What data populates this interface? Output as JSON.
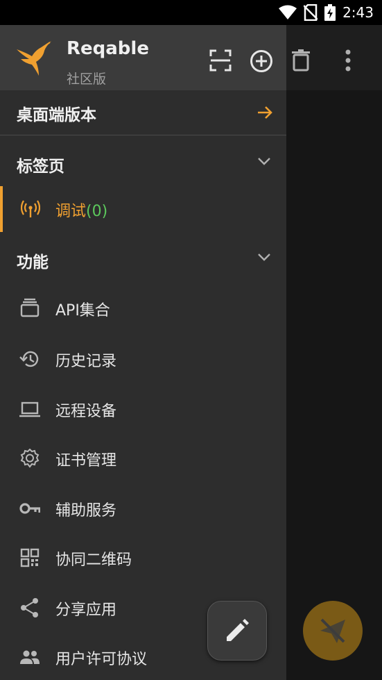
{
  "status": {
    "time": "2:43"
  },
  "header": {
    "app_name": "Reqable",
    "edition": "社区版"
  },
  "desktop": {
    "label": "桌面端版本"
  },
  "tabs_section": {
    "title": "标签页"
  },
  "active_tab": {
    "label": "调试",
    "count": "(0)"
  },
  "features_section": {
    "title": "功能"
  },
  "menu": [
    {
      "label": "API集合",
      "icon": "collection-icon"
    },
    {
      "label": "历史记录",
      "icon": "history-icon"
    },
    {
      "label": "远程设备",
      "icon": "laptop-icon"
    },
    {
      "label": "证书管理",
      "icon": "certificate-icon"
    },
    {
      "label": "辅助服务",
      "icon": "key-icon"
    },
    {
      "label": "协同二维码",
      "icon": "qr-code-icon"
    },
    {
      "label": "分享应用",
      "icon": "share-icon"
    },
    {
      "label": "用户许可协议",
      "icon": "people-icon"
    }
  ],
  "colors": {
    "accent": "#f0a030",
    "count": "#5cc85c",
    "drawer_bg": "#2d2d2d",
    "header_bg": "#3b3b3b"
  }
}
